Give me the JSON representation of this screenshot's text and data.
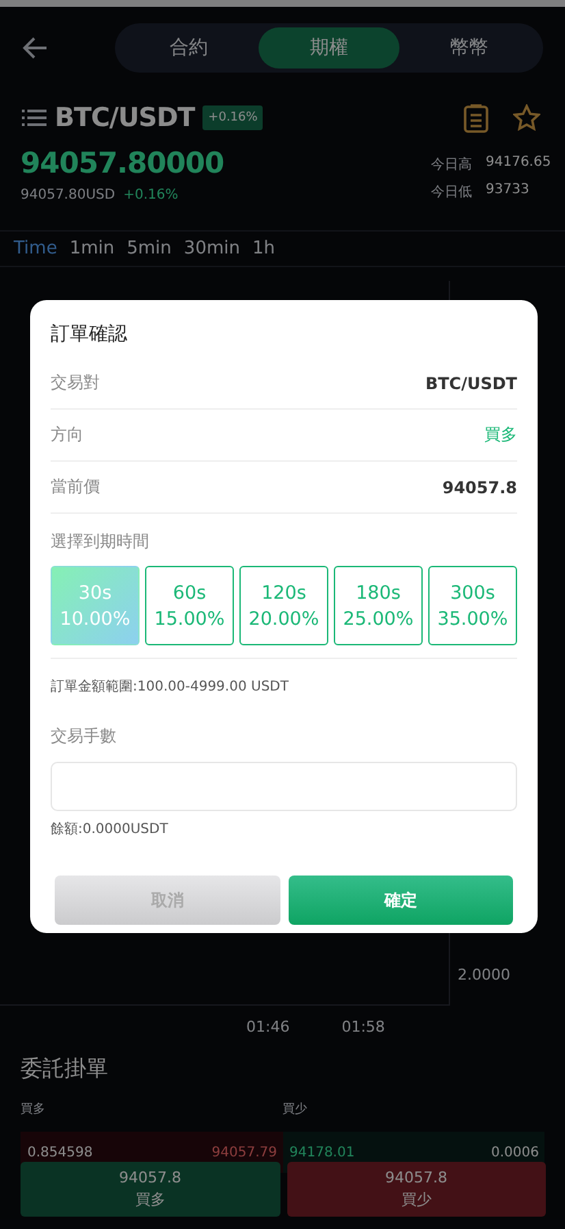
{
  "header": {
    "tabs": [
      {
        "label": "合約",
        "selected": false
      },
      {
        "label": "期權",
        "selected": true
      },
      {
        "label": "幣幣",
        "selected": false
      }
    ]
  },
  "pair": {
    "symbol": "BTC/USDT",
    "change_badge": "+0.16%",
    "price": "94057.80000",
    "usd_price": "94057.80USD",
    "change": "+0.16%",
    "high_label": "今日高",
    "high": "94176.65",
    "low_label": "今日低",
    "low": "93733"
  },
  "timeframes": [
    {
      "label": "Time",
      "selected": true
    },
    {
      "label": "1min",
      "selected": false
    },
    {
      "label": "5min",
      "selected": false
    },
    {
      "label": "30min",
      "selected": false
    },
    {
      "label": "1h",
      "selected": false
    }
  ],
  "chart": {
    "y_label": "2.0000",
    "x_labels": [
      "01:46",
      "01:58"
    ]
  },
  "order_book": {
    "title": "委託掛單",
    "buy_header": "買多",
    "sell_header": "買少",
    "buy_row": {
      "amount": "0.854598",
      "price": "94057.79"
    },
    "sell_row": {
      "price": "94178.01",
      "amount": "0.0006"
    }
  },
  "bottom_buttons": [
    {
      "kind": "buy",
      "price": "94057.8",
      "label": "買多"
    },
    {
      "kind": "sell",
      "price": "94057.8",
      "label": "買少"
    }
  ],
  "dialog": {
    "title": "訂單確認",
    "rows": [
      {
        "label": "交易對",
        "value": "BTC/USDT",
        "kind": "plain"
      },
      {
        "label": "方向",
        "value": "買多",
        "kind": "direction"
      },
      {
        "label": "當前價",
        "value": "94057.8",
        "kind": "plain"
      }
    ],
    "duration_label": "選擇到期時間",
    "durations": [
      {
        "time": "30s",
        "rate": "10.00%",
        "selected": true
      },
      {
        "time": "60s",
        "rate": "15.00%",
        "selected": false
      },
      {
        "time": "120s",
        "rate": "20.00%",
        "selected": false
      },
      {
        "time": "180s",
        "rate": "25.00%",
        "selected": false
      },
      {
        "time": "300s",
        "rate": "35.00%",
        "selected": false
      }
    ],
    "range_note": "訂單金額範圍:100.00-4999.00 USDT",
    "amount_label": "交易手數",
    "balance": "餘額:0.0000USDT",
    "cancel": "取消",
    "confirm": "確定"
  }
}
